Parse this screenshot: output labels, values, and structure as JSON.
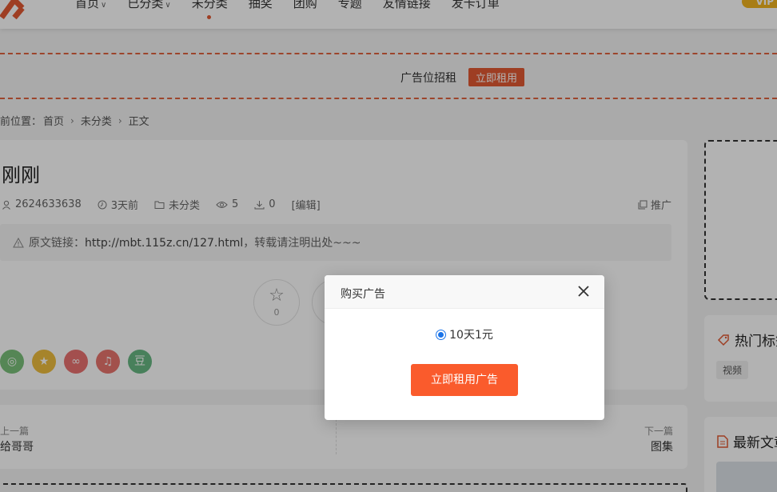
{
  "header": {
    "nav": [
      {
        "label": "首页",
        "has_caret": true
      },
      {
        "label": "已分类",
        "has_caret": true
      },
      {
        "label": "未分类",
        "has_caret": false,
        "active": true
      },
      {
        "label": "抽奖",
        "has_caret": false
      },
      {
        "label": "团购",
        "has_caret": false
      },
      {
        "label": "专题",
        "has_caret": false
      },
      {
        "label": "友情链接",
        "has_caret": false
      },
      {
        "label": "发卡订单",
        "has_caret": false
      }
    ],
    "vip_label": "VIP",
    "accent_color": "#e25a33"
  },
  "ad_banner": {
    "text": "广告位招租",
    "button": "立即租用"
  },
  "breadcrumb": {
    "prefix": "前位置：",
    "items": [
      "首页",
      "未分类",
      "正文"
    ]
  },
  "article": {
    "title": "刚刚",
    "author": "2624633638",
    "time": "3天前",
    "category": "未分类",
    "views": "5",
    "downloads": "0",
    "edit": "[编辑]",
    "promo": "推广",
    "source_label": "原文链接：",
    "source_url": "http://mbt.115z.cn/127.html",
    "source_suffix": "，转载请注明出处~~~",
    "like_count": "0",
    "share_icons": [
      {
        "name": "wechat-icon",
        "glyph": "◎",
        "color": "#7ac17a"
      },
      {
        "name": "qzone-icon",
        "glyph": "★",
        "color": "#eebd3e"
      },
      {
        "name": "weibo-icon",
        "glyph": "∞",
        "color": "#ea7270"
      },
      {
        "name": "qq-icon",
        "glyph": "♫",
        "color": "#e8746e"
      },
      {
        "name": "douban-icon",
        "glyph": "豆",
        "color": "#68b883"
      }
    ]
  },
  "prev_next": {
    "prev_label": "上一篇",
    "prev_title": "给哥哥",
    "next_label": "下一篇",
    "next_title": "图集"
  },
  "sidebar": {
    "hot_tags_title": "热门标签",
    "tags": [
      "视频"
    ],
    "latest_title": "最新文章"
  },
  "modal": {
    "title": "购买广告",
    "option_label": "10天1元",
    "option_selected": true,
    "submit_label": "立即租用广告"
  }
}
